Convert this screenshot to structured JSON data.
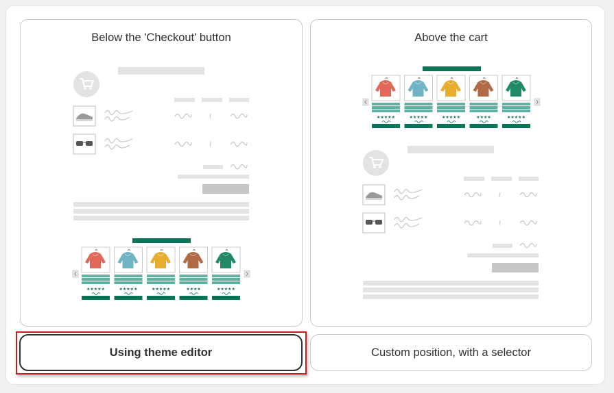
{
  "cards": [
    {
      "title": "Below the 'Checkout' button"
    },
    {
      "title": "Above the cart"
    }
  ],
  "options": [
    {
      "label": "Using theme editor",
      "selected": true
    },
    {
      "label": "Custom position, with a selector",
      "selected": false
    }
  ],
  "colors": {
    "accent_green": "#0b7457",
    "teal_bars": "#60b0a4",
    "focus_red": "#d3191c",
    "placeholder_gray": "#e3e3e3",
    "hoodies": [
      "#e2685a",
      "#6fb3c4",
      "#e8ad2e",
      "#b06a45",
      "#1f8a63"
    ]
  },
  "icons": {
    "cart": "cart-icon",
    "shoe": "sneaker-icon",
    "glasses": "sunglasses-icon",
    "hoodie": "hoodie-icon",
    "prev": "chevron-left-icon",
    "next": "chevron-right-icon"
  }
}
